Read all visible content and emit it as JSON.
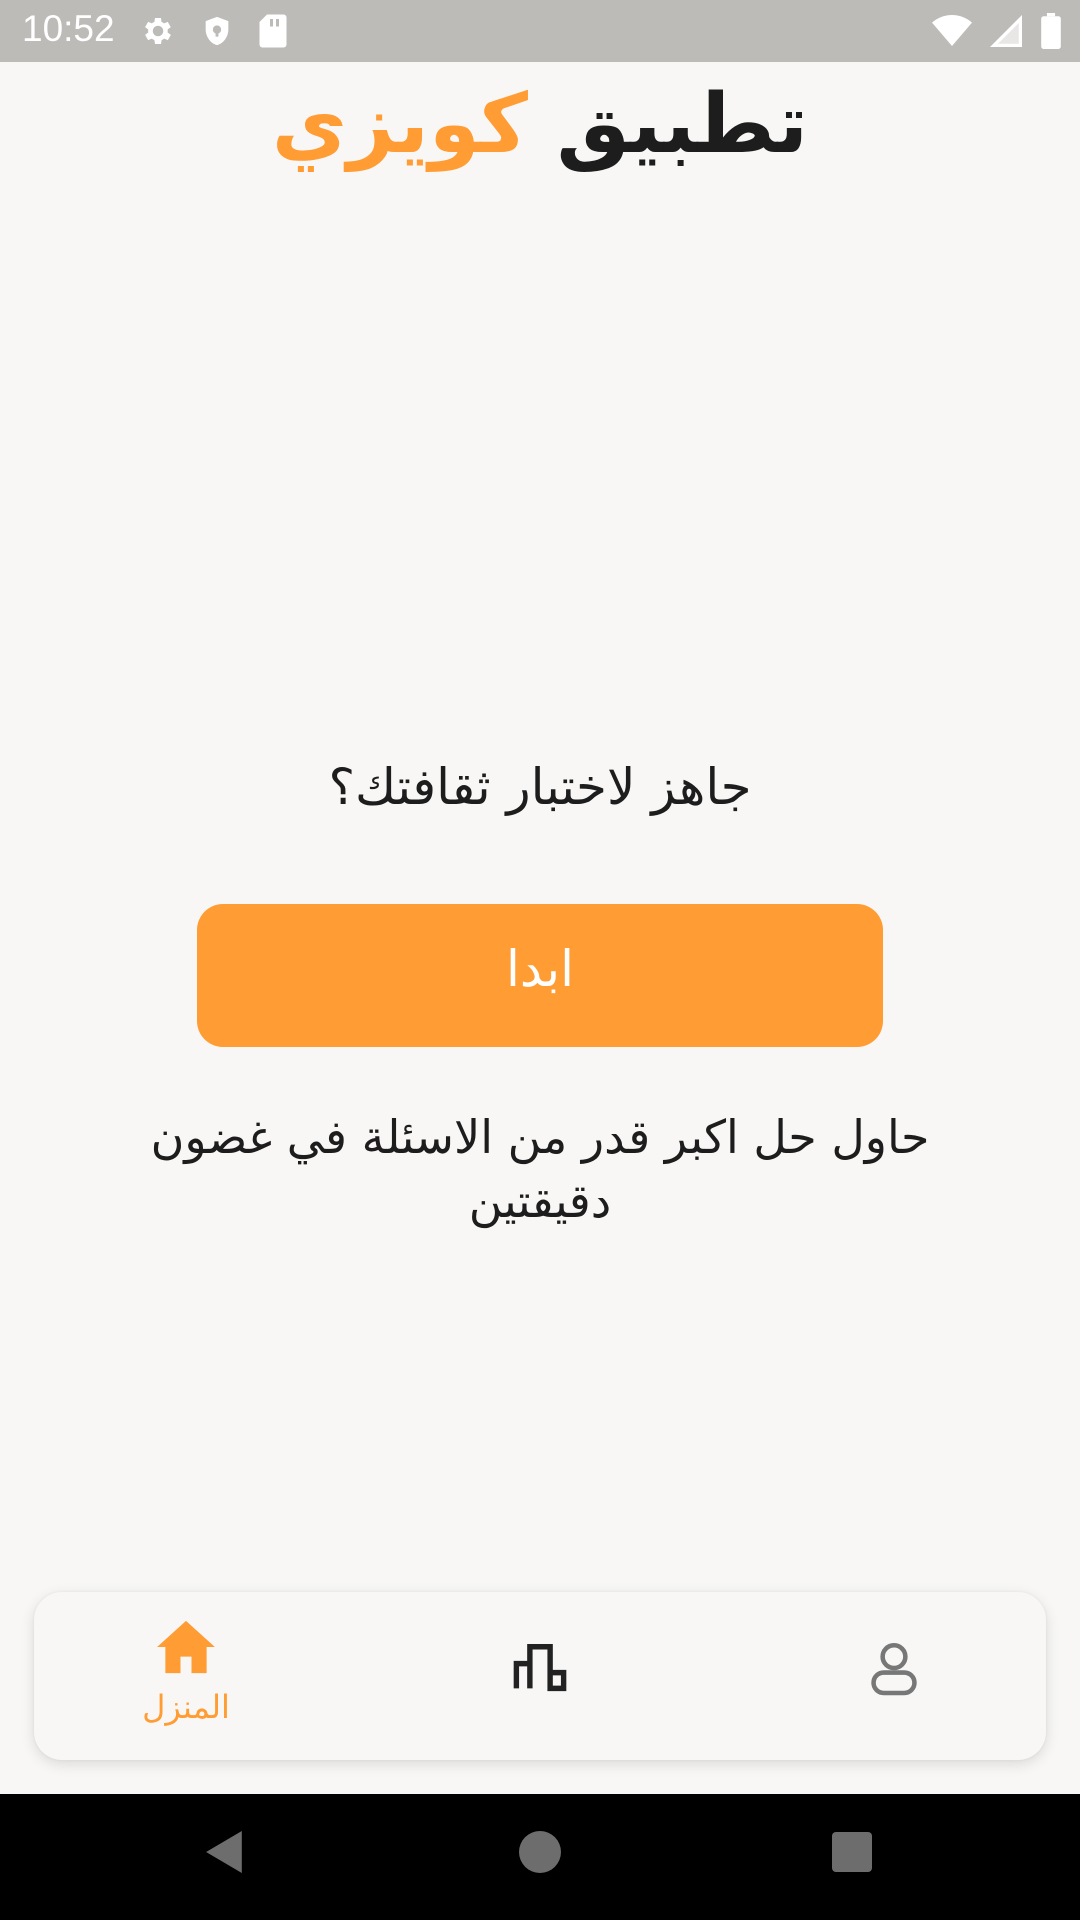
{
  "status_bar": {
    "time": "10:52",
    "left_icons": [
      "gear-icon",
      "shield-icon",
      "sd-card-icon"
    ],
    "right_icons": [
      "wifi-icon",
      "signal-icon",
      "battery-icon"
    ]
  },
  "header": {
    "title_word_1": "تطبيق",
    "title_word_2": "كويزي",
    "accent_color": "#ff9c33"
  },
  "main": {
    "question": "جاهز لاختبار ثقافتك؟",
    "start_button_label": "ابدا",
    "hint": "حاول حل اكبر قدر من الاسئلة في غضون دقيقتين"
  },
  "bottom_nav": {
    "items": [
      {
        "icon": "home-icon",
        "label": "المنزل",
        "active": true
      },
      {
        "icon": "leaderboard-icon",
        "active": false
      },
      {
        "icon": "profile-icon",
        "active": false
      }
    ]
  },
  "system_nav": {
    "buttons": [
      "back-icon",
      "home-circle-icon",
      "recents-icon"
    ]
  }
}
